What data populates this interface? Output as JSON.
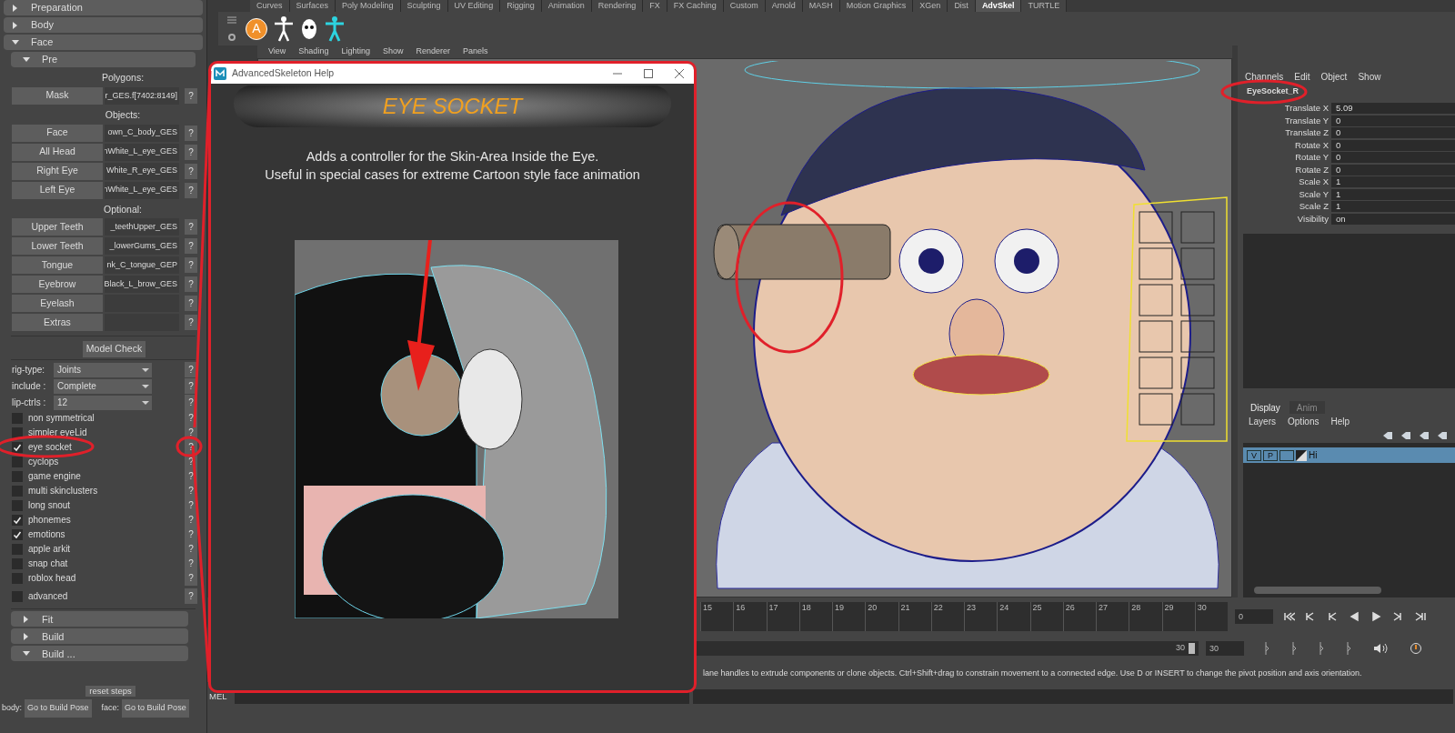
{
  "left_panel": {
    "sections": [
      {
        "label": "Preparation",
        "expanded": false
      },
      {
        "label": "Body",
        "expanded": false
      },
      {
        "label": "Face",
        "expanded": true
      }
    ],
    "subsection": {
      "label": "Pre",
      "expanded": true
    },
    "object_groups": [
      {
        "heading": "Polygons:",
        "rows": [
          {
            "label": "Mask",
            "value": "r_GES.f[7402:8149]",
            "help": "?"
          }
        ]
      },
      {
        "heading": "Objects:",
        "rows": [
          {
            "label": "Face",
            "value": "own_C_body_GES",
            "help": "?"
          },
          {
            "label": "All Head",
            "value": "nWhite_L_eye_GES",
            "help": "?"
          },
          {
            "label": "Right Eye",
            "value": "White_R_eye_GES",
            "help": "?"
          },
          {
            "label": "Left Eye",
            "value": "nWhite_L_eye_GES",
            "help": "?"
          }
        ]
      },
      {
        "heading": "Optional:",
        "rows": [
          {
            "label": "Upper Teeth",
            "value": "_teethUpper_GES",
            "help": "?"
          },
          {
            "label": "Lower Teeth",
            "value": "_lowerGums_GES",
            "help": "?"
          },
          {
            "label": "Tongue",
            "value": "nk_C_tongue_GEP",
            "help": "?"
          },
          {
            "label": "Eyebrow",
            "value": "Black_L_brow_GES",
            "help": "?"
          },
          {
            "label": "Eyelash",
            "value": "",
            "help": "?"
          },
          {
            "label": "Extras",
            "value": "",
            "help": "?"
          }
        ]
      }
    ],
    "model_check": "Model Check",
    "dropdowns": [
      {
        "label": "rig-type:",
        "value": "Joints",
        "help": "?"
      },
      {
        "label": "include :",
        "value": "Complete",
        "help": "?"
      },
      {
        "label": "lip-ctrls :",
        "value": "12",
        "help": "?"
      }
    ],
    "options": [
      {
        "label": "non symmetrical",
        "checked": false,
        "help": "?"
      },
      {
        "label": "simpler eyeLid",
        "checked": false,
        "help": "?"
      },
      {
        "label": "eye socket",
        "checked": true,
        "help": "?"
      },
      {
        "label": "cyclops",
        "checked": false,
        "help": "?"
      },
      {
        "label": "game engine",
        "checked": false,
        "help": "?"
      },
      {
        "label": "multi skinclusters",
        "checked": false,
        "help": "?"
      },
      {
        "label": "long snout",
        "checked": false,
        "help": "?"
      },
      {
        "label": "phonemes",
        "checked": true,
        "help": "?"
      },
      {
        "label": "emotions",
        "checked": true,
        "help": "?"
      },
      {
        "label": "apple arkit",
        "checked": false,
        "help": "?"
      },
      {
        "label": "snap chat",
        "checked": false,
        "help": "?"
      },
      {
        "label": "roblox head",
        "checked": false,
        "help": "?"
      },
      {
        "label": "advanced",
        "checked": false,
        "help": "?"
      }
    ],
    "bottom_sections": [
      {
        "label": "Fit",
        "expanded": false
      },
      {
        "label": "Build",
        "expanded": false
      },
      {
        "label": "Build ...",
        "expanded": true
      }
    ],
    "reset_steps": "reset steps",
    "pose_buttons": [
      {
        "label": "body:",
        "button": "Go to Build Pose"
      },
      {
        "label": "face:",
        "button": "Go to Build Pose"
      }
    ]
  },
  "shelf": {
    "tabs": [
      {
        "label": "Curves",
        "selected": false
      },
      {
        "label": "Surfaces",
        "selected": false
      },
      {
        "label": "Poly Modeling",
        "selected": false
      },
      {
        "label": "Sculpting",
        "selected": false
      },
      {
        "label": "UV Editing",
        "selected": false
      },
      {
        "label": "Rigging",
        "selected": false
      },
      {
        "label": "Animation",
        "selected": false
      },
      {
        "label": "Rendering",
        "selected": false
      },
      {
        "label": "FX",
        "selected": false
      },
      {
        "label": "FX Caching",
        "selected": false
      },
      {
        "label": "Custom",
        "selected": false
      },
      {
        "label": "Arnold",
        "selected": false
      },
      {
        "label": "MASH",
        "selected": false
      },
      {
        "label": "Motion Graphics",
        "selected": false
      },
      {
        "label": "XGen",
        "selected": false
      },
      {
        "label": "Dist",
        "selected": false
      },
      {
        "label": "AdvSkel",
        "selected": true
      },
      {
        "label": "TURTLE",
        "selected": false
      }
    ],
    "logo_letter": "A"
  },
  "viewport": {
    "menu": [
      "View",
      "Shading",
      "Lighting",
      "Show",
      "Renderer",
      "Panels"
    ]
  },
  "channel_box": {
    "menu": [
      "Channels",
      "Edit",
      "Object",
      "Show"
    ],
    "object": "EyeSocket_R",
    "attributes": [
      {
        "name": "Translate X",
        "value": "5.09"
      },
      {
        "name": "Translate Y",
        "value": "0"
      },
      {
        "name": "Translate Z",
        "value": "0"
      },
      {
        "name": "Rotate X",
        "value": "0"
      },
      {
        "name": "Rotate Y",
        "value": "0"
      },
      {
        "name": "Rotate Z",
        "value": "0"
      },
      {
        "name": "Scale X",
        "value": "1"
      },
      {
        "name": "Scale Y",
        "value": "1"
      },
      {
        "name": "Scale Z",
        "value": "1"
      },
      {
        "name": "Visibility",
        "value": "on"
      }
    ]
  },
  "layer_editor": {
    "tabs": [
      {
        "label": "Display",
        "selected": true
      },
      {
        "label": "Anim",
        "selected": false
      }
    ],
    "menu": [
      "Layers",
      "Options",
      "Help"
    ],
    "layers": [
      {
        "visible": "V",
        "playback": "P",
        "name": "Hi",
        "selected": true
      }
    ]
  },
  "timeline": {
    "frames": [
      "15",
      "16",
      "17",
      "18",
      "19",
      "20",
      "21",
      "22",
      "23",
      "24",
      "25",
      "26",
      "27",
      "28",
      "29",
      "30"
    ],
    "current_frame": "0",
    "range_slider": {
      "end_label": "30",
      "level": 1
    },
    "end_field": "30"
  },
  "help_line": "lane handles to extrude components or clone objects. Ctrl+Shift+drag to constrain movement to a connected edge. Use D or INSERT to change the pivot position and axis orientation.",
  "command_line": {
    "label": "MEL"
  },
  "help_dialog": {
    "title": "AdvancedSkeleton Help",
    "heading": "EYE SOCKET",
    "description": [
      "Adds a controller for the Skin-Area Inside the Eye.",
      "Useful in special cases for extreme Cartoon style face animation"
    ]
  }
}
